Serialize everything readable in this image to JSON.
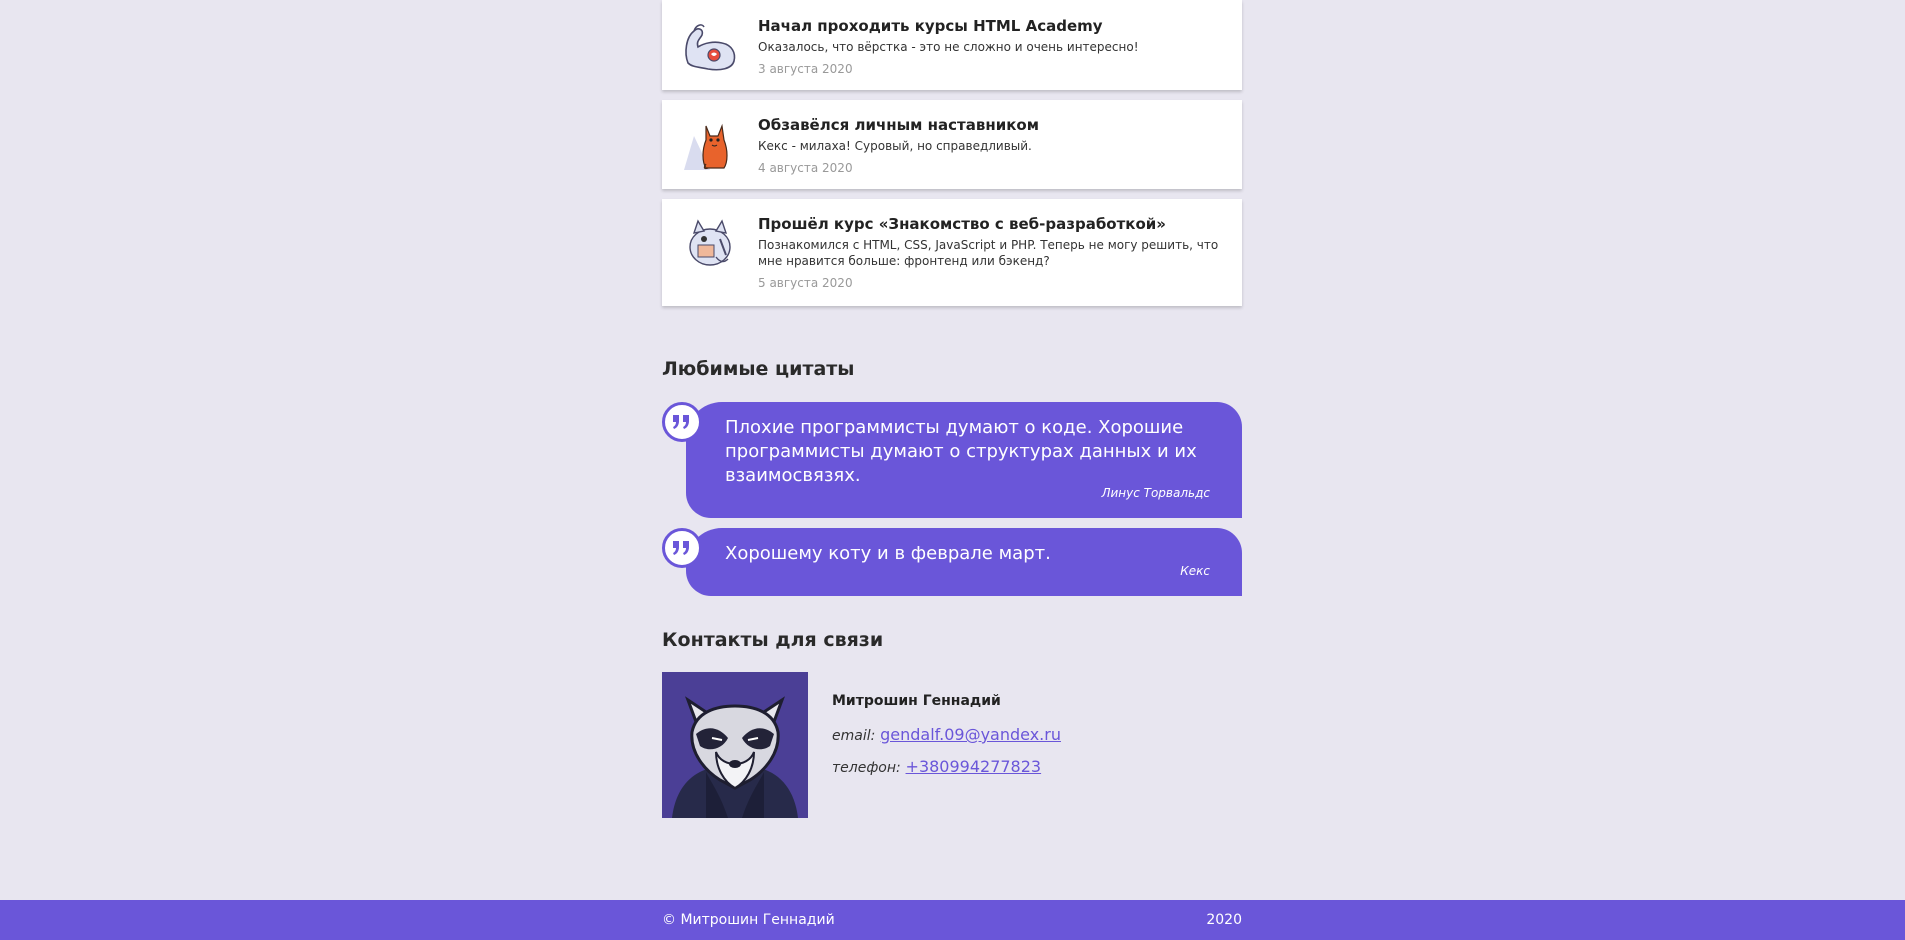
{
  "achievements": [
    {
      "title": "Начал проходить курсы HTML Academy",
      "text": "Оказалось, что вёрстка - это не сложно и очень интересно!",
      "date": "3 августа 2020",
      "icon": "muscle-arm-icon"
    },
    {
      "title": "Обзавёлся личным наставником",
      "text": "Кекс - милаха! Суровый, но справедливый.",
      "date": "4 августа 2020",
      "icon": "keks-cat-icon"
    },
    {
      "title": "Прошёл курс «Знакомство с веб-разработкой»",
      "text": "Познакомился с HTML, CSS, JavaScript и PHP. Теперь не могу решить, что мне нравится больше: фронтенд или бэкенд?",
      "date": "5 августа 2020",
      "icon": "pirate-cat-icon"
    }
  ],
  "quotes": {
    "title": "Любимые цитаты",
    "items": [
      {
        "text": "Плохие программисты думают о коде. Хорошие программисты думают о структурах данных и их взаимосвязях.",
        "author": "Линус Торвальдс"
      },
      {
        "text": "Хорошему коту и в феврале март.",
        "author": "Кекс"
      }
    ]
  },
  "contacts": {
    "title": "Контакты для связи",
    "name": "Митрошин Геннадий",
    "email_label": "email:",
    "email": "gendalf.09@yandex.ru",
    "phone_label": "телефон:",
    "phone": "+380994277823",
    "avatar": "raccoon-avatar"
  },
  "footer": {
    "copyright": "© Митрошин Геннадий",
    "year": "2020"
  },
  "colors": {
    "accent": "#6a56d9",
    "background": "#e8e6f0"
  }
}
